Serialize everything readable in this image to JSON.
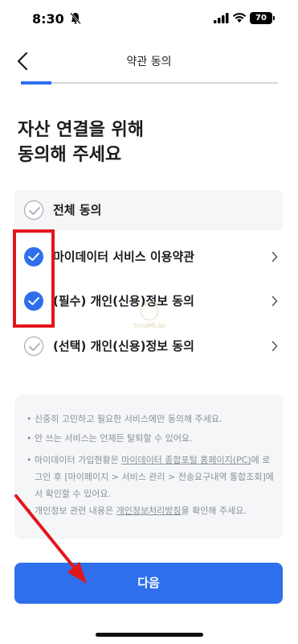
{
  "status_bar": {
    "time": "8:30",
    "battery": "70"
  },
  "header": {
    "title": "약관 동의"
  },
  "progress": {
    "fraction": 0.12
  },
  "heading": {
    "line1": "자산 연결을 위해",
    "line2": "동의해 주세요"
  },
  "consents": {
    "all": {
      "label": "전체 동의",
      "checked": false
    },
    "items": [
      {
        "label": "마이데이터 서비스 이용약관",
        "checked": true
      },
      {
        "label": "(필수) 개인(신용)정보 동의",
        "checked": true
      },
      {
        "label": "(선택) 개인(신용)정보 동의",
        "checked": false
      }
    ]
  },
  "watermark": {
    "text": "SoraMLab"
  },
  "notice": {
    "bullet": "•",
    "item1": "신중히 고민하고 필요한 서비스에만 동의해 주세요.",
    "item2": "안 쓰는 서비스는 언제든 탈퇴할 수 있어요.",
    "item3_pre": "마이데이터 가입현황은 ",
    "item3_link1": "마이데이터 종합포털 홈페이지(PC)",
    "item3_mid": "에 로그인 후 [마이페이지 > 서비스 관리 > 전송요구내역 통합조회]에서 확인할 수 있어요.",
    "item4_pre": "개인정보 관련 내용은 ",
    "item4_link": "개인정보처리방침",
    "item4_post": "을 확인해 주세요."
  },
  "next_button": {
    "label": "다음"
  },
  "colors": {
    "accent": "#2f6fec",
    "annotation": "#e3161c"
  }
}
